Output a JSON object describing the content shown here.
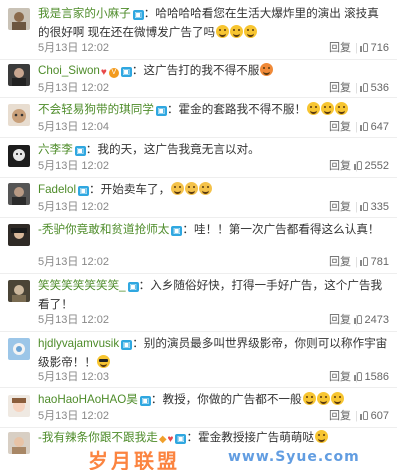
{
  "colors": {
    "username": "#4e8c2a",
    "text": "#333333",
    "meta": "#888888"
  },
  "labels": {
    "reply": "回复",
    "like_icon": "thumbs-up-icon"
  },
  "comments": [
    {
      "user": "我是言家的小麻子",
      "text": "：哈哈哈哈看您在生活大爆炸里的演出 滚技真的很好啊 现在还在微博发广告了吗",
      "emojis": 3,
      "date": "5月13日",
      "time": "12:02",
      "likes": "716"
    },
    {
      "user": "Choi_Siwon",
      "text": "：这广告打的我不得不服",
      "emojis": 1,
      "date": "5月13日",
      "time": "12:02",
      "likes": "536"
    },
    {
      "user": "不会轻易狗带的琪同学",
      "text": "：霍金的套路我不得不服！",
      "emojis": 3,
      "date": "5月13日",
      "time": "12:04",
      "likes": "647"
    },
    {
      "user": "六李李",
      "text": "：我的天，这广告我竟无言以对。",
      "emojis": 0,
      "date": "5月13日",
      "time": "12:02",
      "likes": "2552"
    },
    {
      "user": "Fadelol",
      "text": "：开始卖车了，",
      "emojis": 3,
      "date": "5月13日",
      "time": "12:02",
      "likes": "335"
    },
    {
      "user": "-秃驴你竟敢和贫道抢师太",
      "text": "：哇！！第一次广告都看得这么认真！",
      "emojis": 0,
      "date": "5月13日",
      "time": "12:02",
      "likes": "781"
    },
    {
      "user": "笑笑笑笑笑笑笑_",
      "text": "：入乡随俗好快，打得一手好广告，这个广告我看了！",
      "emojis": 0,
      "date": "5月13日",
      "time": "12:02",
      "likes": "2473"
    },
    {
      "user": "hjdlyvajamvusik",
      "text": "：别的演员最多叫世界级影帝，你则可以称作宇宙级影帝！！",
      "emojis": 1,
      "date": "5月13日",
      "time": "12:03",
      "likes": "1586"
    },
    {
      "user": "haoHaoHAoHAO昊",
      "text": "：教授，你做的广告都不一般",
      "emojis": 3,
      "date": "5月13日",
      "time": "12:02",
      "likes": "607"
    },
    {
      "user": "-我有辣条你跟不跟我走",
      "text": "：霍金教授接广告萌萌哒",
      "emojis": 1,
      "date": "",
      "time": "",
      "likes": ""
    }
  ],
  "watermark": {
    "text": "岁月联盟",
    "url": "www.Syue.com"
  }
}
